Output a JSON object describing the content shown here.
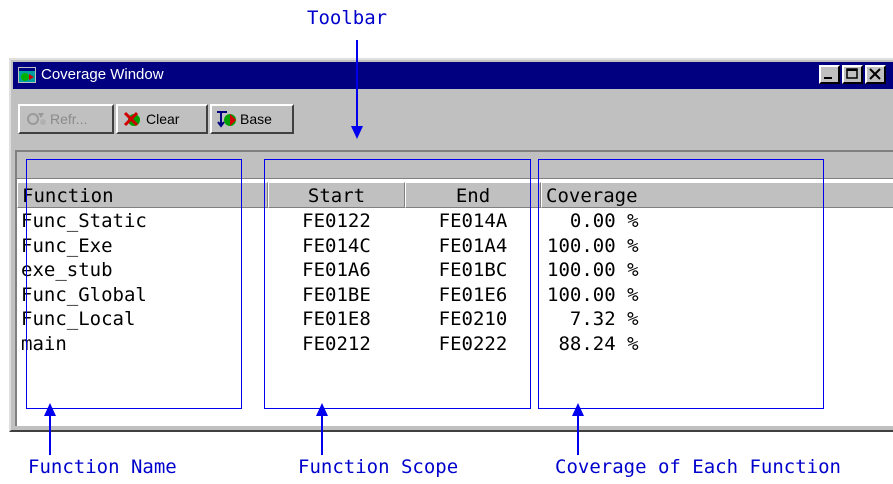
{
  "annotations": {
    "toolbar": "Toolbar",
    "function_name": "Function Name",
    "function_scope": "Function Scope",
    "coverage_each": "Coverage of Each Function"
  },
  "window": {
    "title": "Coverage Window"
  },
  "toolbar": {
    "refresh_label": "Refr...",
    "clear_label": "Clear",
    "base_label": "Base"
  },
  "table": {
    "headers": {
      "function": "Function",
      "start": "Start",
      "end": "End",
      "coverage": "Coverage"
    },
    "rows": [
      {
        "function": "Func_Static",
        "start": "FE0122",
        "end": "FE014A",
        "coverage": "  0.00 %"
      },
      {
        "function": "Func_Exe",
        "start": "FE014C",
        "end": "FE01A4",
        "coverage": "100.00 %"
      },
      {
        "function": "exe_stub",
        "start": "FE01A6",
        "end": "FE01BC",
        "coverage": "100.00 %"
      },
      {
        "function": "Func_Global",
        "start": "FE01BE",
        "end": "FE01E6",
        "coverage": "100.00 %"
      },
      {
        "function": "Func_Local",
        "start": "FE01E8",
        "end": "FE0210",
        "coverage": "  7.32 %"
      },
      {
        "function": "main",
        "start": "FE0212",
        "end": "FE0222",
        "coverage": " 88.24 %"
      }
    ]
  },
  "colors": {
    "annotation": "#0000cc",
    "titlebar": "#000080",
    "window_face": "#c0c0c0"
  }
}
